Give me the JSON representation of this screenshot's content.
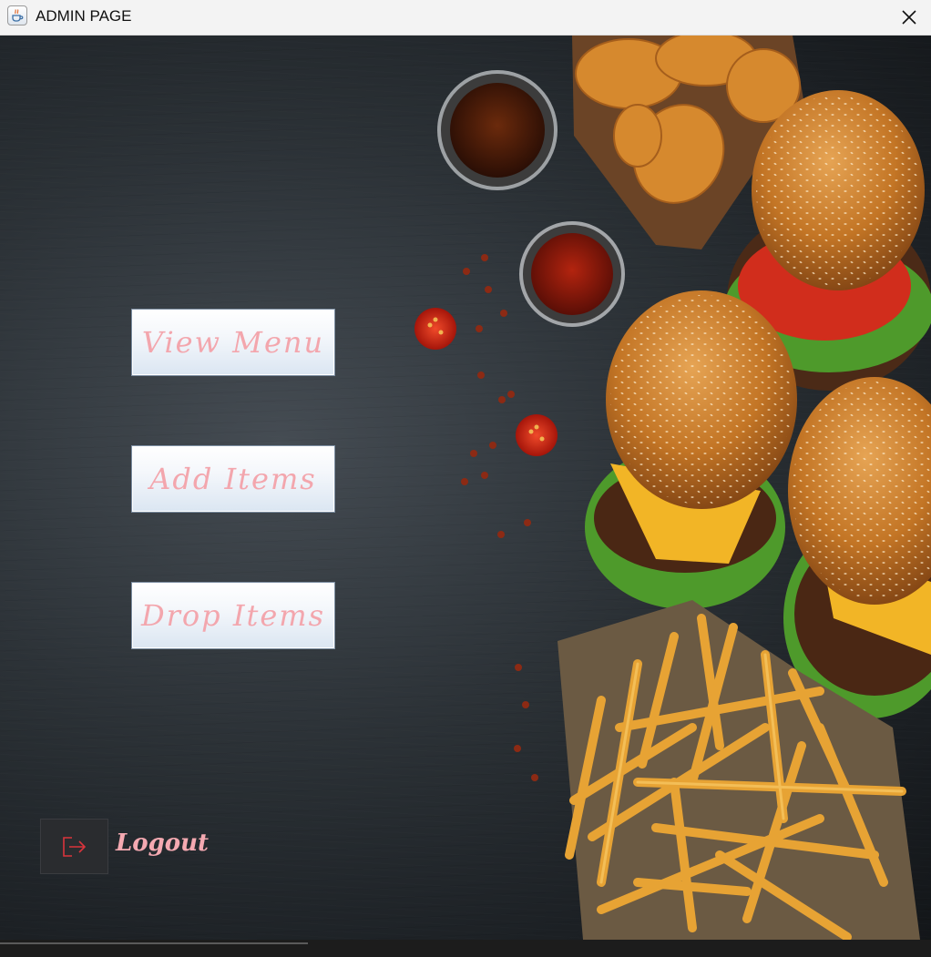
{
  "window": {
    "title": "ADMIN PAGE"
  },
  "menu": {
    "view_menu": "View Menu",
    "add_items": "Add Items",
    "drop_items": "Drop Items"
  },
  "logout": {
    "label": "Logout"
  },
  "icons": {
    "app": "java-cup-icon",
    "close": "close-icon",
    "logout": "logout-icon"
  },
  "colors": {
    "button_text": "#f3a6ad",
    "logout_text": "#f4a9b1",
    "logout_icon": "#d9343c"
  }
}
